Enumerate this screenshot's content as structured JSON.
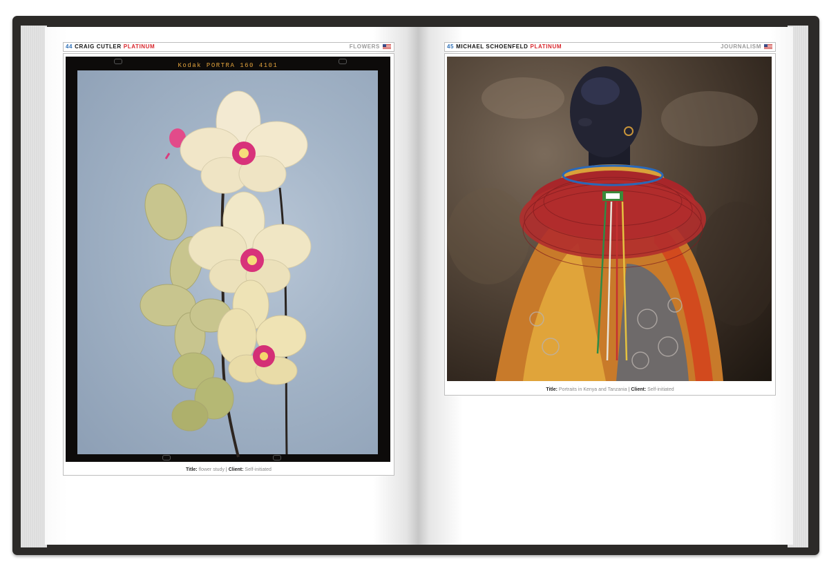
{
  "left_page": {
    "page_number": "44",
    "photographer": "CRAIG CUTLER",
    "award": "PLATINUM",
    "category": "FLOWERS",
    "film_code": "Kodak  PORTRA  160  4101",
    "caption": {
      "title_label": "Title:",
      "title_value": "flower study",
      "separator": "|",
      "client_label": "Client:",
      "client_value": "Self-initiated"
    }
  },
  "right_page": {
    "page_number": "45",
    "photographer": "MICHAEL SCHOENFELD",
    "award": "PLATINUM",
    "category": "JOURNALISM",
    "caption": {
      "title_label": "Title:",
      "title_value": "Portraits in Kenya and Tanzania",
      "separator": "|",
      "client_label": "Client:",
      "client_value": "Self-initiated"
    }
  },
  "icons": [
    "us-flag-icon"
  ],
  "colors": {
    "page_number": "#2c6fb7",
    "award": "#d8262c",
    "category": "#9a9a9a",
    "film_code": "#e0a13c",
    "cover": "#2c2a28"
  }
}
